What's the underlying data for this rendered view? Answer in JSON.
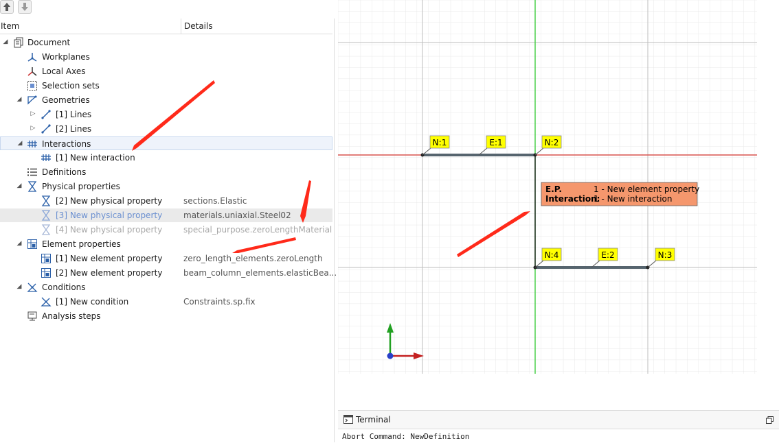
{
  "toolbar": {
    "up_icon": "arrow-up-icon",
    "down_icon": "arrow-down-icon"
  },
  "tree": {
    "columns": {
      "item": "Item",
      "details": "Details"
    },
    "rows": [
      {
        "label": "Document",
        "details": "",
        "icon": "document-icon",
        "arrow": "◢"
      },
      {
        "label": "Workplanes",
        "details": "",
        "icon": "workplanes-icon",
        "arrow": ""
      },
      {
        "label": "Local Axes",
        "details": "",
        "icon": "local-axes-icon",
        "arrow": ""
      },
      {
        "label": "Selection sets",
        "details": "",
        "icon": "selection-sets-icon",
        "arrow": ""
      },
      {
        "label": "Geometries",
        "details": "",
        "icon": "geometries-icon",
        "arrow": "◢"
      },
      {
        "label": "[1] Lines",
        "details": "",
        "icon": "line-icon",
        "arrow": "▷"
      },
      {
        "label": "[2] Lines",
        "details": "",
        "icon": "line-icon",
        "arrow": "▷"
      },
      {
        "label": "Interactions",
        "details": "",
        "icon": "interaction-icon",
        "arrow": "◢"
      },
      {
        "label": "[1] New interaction",
        "details": "",
        "icon": "interaction-icon",
        "arrow": ""
      },
      {
        "label": "Definitions",
        "details": "",
        "icon": "definitions-icon",
        "arrow": ""
      },
      {
        "label": "Physical properties",
        "details": "",
        "icon": "physical-property-icon",
        "arrow": "◢"
      },
      {
        "label": "[2] New physical property",
        "details": "sections.Elastic",
        "icon": "physical-property-icon",
        "arrow": ""
      },
      {
        "label": "[3] New physical property",
        "details": "materials.uniaxial.Steel02",
        "icon": "physical-property-icon",
        "arrow": ""
      },
      {
        "label": "[4] New physical property",
        "details": "special_purpose.zeroLengthMaterial",
        "icon": "physical-property-icon",
        "arrow": ""
      },
      {
        "label": "Element properties",
        "details": "",
        "icon": "element-property-icon",
        "arrow": "◢"
      },
      {
        "label": "[1] New element property",
        "details": "zero_length_elements.zeroLength",
        "icon": "element-property-icon",
        "arrow": ""
      },
      {
        "label": "[2] New element property",
        "details": "beam_column_elements.elasticBea...",
        "icon": "element-property-icon",
        "arrow": ""
      },
      {
        "label": "Conditions",
        "details": "",
        "icon": "condition-icon",
        "arrow": "◢"
      },
      {
        "label": "[1] New condition",
        "details": "Constraints.sp.fix",
        "icon": "condition-icon",
        "arrow": ""
      },
      {
        "label": "Analysis steps",
        "details": "",
        "icon": "analysis-steps-icon",
        "arrow": ""
      }
    ]
  },
  "viewport": {
    "node_labels": [
      "N:1",
      "E:1",
      "N:2",
      "N:4",
      "E:2",
      "N:3"
    ],
    "tooltip": {
      "line1_key": "E.P.",
      "line1_value": "1 - New element property",
      "line2_key": "Interaction:",
      "line2_value": "1 - New interaction"
    },
    "colors": {
      "x_axis": "#d9534f",
      "y_axis": "#4cd04c",
      "element": "#56646e",
      "label_bg": "#ffff00",
      "tooltip_bg": "#f5976d",
      "annotation": "#ff2a1a"
    }
  },
  "terminal": {
    "title": "Terminal",
    "output": "Abort Command: NewDefinition",
    "icon": "terminal-icon",
    "float_icon": "restore-window-icon"
  }
}
